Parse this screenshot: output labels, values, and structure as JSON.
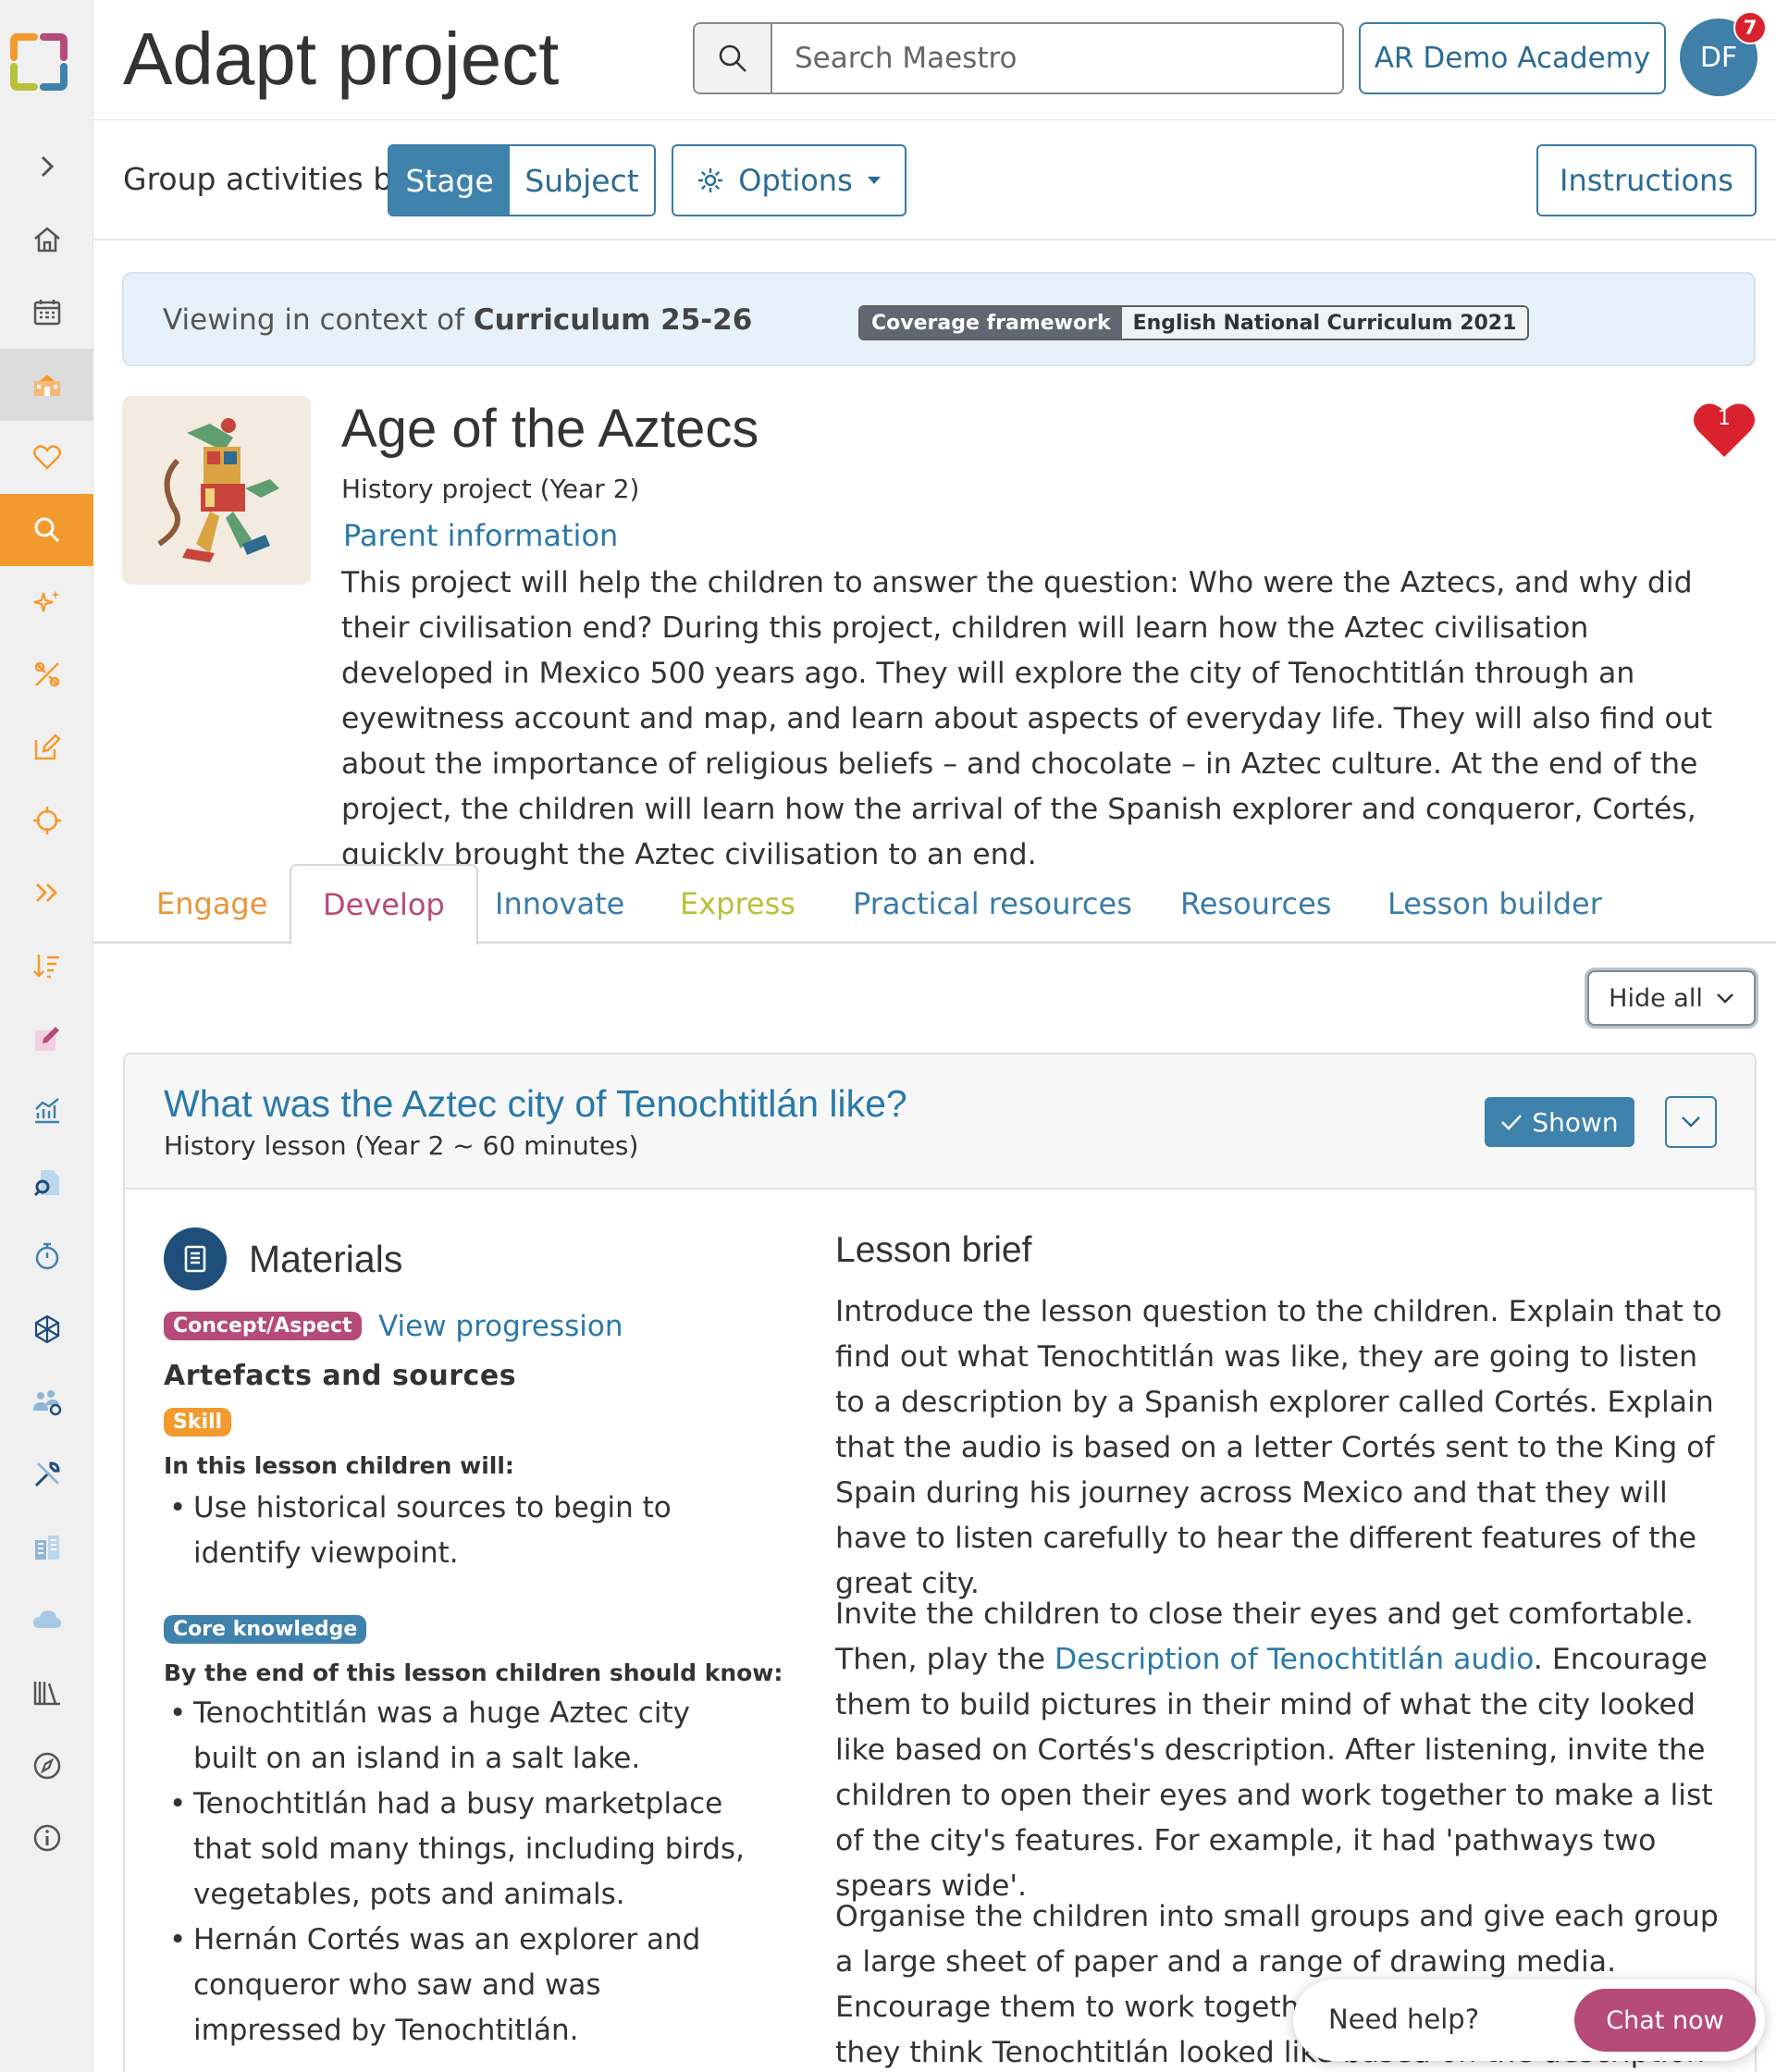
{
  "header": {
    "title": "Adapt project",
    "search_placeholder": "Search Maestro",
    "school": "AR Demo Academy",
    "avatar_initials": "DF",
    "notification_count": "7"
  },
  "toolbar": {
    "group_label": "Group activities by",
    "segments": [
      "Stage",
      "Subject"
    ],
    "active_segment": "Stage",
    "options_label": "Options",
    "instructions_label": "Instructions"
  },
  "context": {
    "prefix": "Viewing in context of ",
    "curriculum": "Curriculum 25-26",
    "badge_key": "Coverage framework",
    "badge_value": "English National Curriculum 2021"
  },
  "project": {
    "title": "Age of the Aztecs",
    "subtitle": "History project (Year 2)",
    "parent_link": "Parent information",
    "description": "This project will help the children to answer the question: Who were the Aztecs, and why did their civilisation end? During this project, children will learn how the Aztec civilisation developed in Mexico 500 years ago. They will explore the city of Tenochtitlán through an eyewitness account and map, and learn about aspects of everyday life. They will also find out about the importance of religious beliefs – and chocolate – in Aztec culture. At the end of the project, the children will learn how the arrival of the Spanish explorer and conqueror, Cortés, quickly brought the Aztec civilisation to an end.",
    "favourite_count": "1"
  },
  "tabs": [
    {
      "label": "Engage",
      "color": "#e8963a"
    },
    {
      "label": "Develop",
      "color": "#b64a79"
    },
    {
      "label": "Innovate",
      "color": "#3a7ca5"
    },
    {
      "label": "Express",
      "color": "#b7c23a"
    },
    {
      "label": "Practical resources",
      "color": "#3a7ca5"
    },
    {
      "label": "Resources",
      "color": "#3a7ca5"
    },
    {
      "label": "Lesson builder",
      "color": "#3a7ca5"
    }
  ],
  "active_tab": "Develop",
  "hide_all_label": "Hide all",
  "lesson": {
    "title": "What was the Aztec city of Tenochtitlán like?",
    "subtitle": "History lesson (Year 2 ~ 60 minutes)",
    "shown_label": "Shown",
    "materials_title": "Materials",
    "concept_tag": "Concept/Aspect",
    "view_progression": "View progression",
    "concept_title": "Artefacts and sources",
    "skill_tag": "Skill",
    "skill_lead": "In this lesson children will:",
    "skill_items": [
      "Use historical sources to begin to identify viewpoint."
    ],
    "core_tag": "Core knowledge",
    "core_lead": "By the end of this lesson children should know:",
    "core_items": [
      "Tenochtitlán was a huge Aztec city built on an island in a salt lake.",
      "Tenochtitlán had a busy marketplace that sold many things, including birds, vegetables, pots and animals.",
      "Hernán Cortés was an explorer and conqueror who saw and was impressed by Tenochtitlán."
    ],
    "brief_title": "Lesson brief",
    "brief_p1": "Introduce the lesson question to the children. Explain that to find out what Tenochtitlán was like, they are going to listen to a description by a Spanish explorer called Cortés. Explain that the audio is based on a letter Cortés sent to the King of Spain during his journey across Mexico and that they will have to listen carefully to hear the different features of the great city.",
    "brief_p2_pre": "Invite the children to close their eyes and get comfortable. Then, play the ",
    "brief_p2_link": "Description of Tenochtitlán audio",
    "brief_p2_post": ". Encourage them to build pictures in their mind of what the city looked like based on Cortés's description. After listening, invite the children to open their eyes and work together to make a list of the city's features. For example, it had 'pathways two spears wide'.",
    "brief_p3": "Organise the children into small groups and give each group a large sheet of paper and a range of drawing media. Encourage them to work together to draw a map of what they think Tenochtitlán looked like based on the description in"
  },
  "chat": {
    "label": "Need help?",
    "button": "Chat now"
  },
  "sidebar_icons": [
    "expand-icon",
    "home-icon",
    "calendar-icon",
    "school-icon",
    "heart-icon",
    "search-icon",
    "sparkle-icon",
    "design-icon",
    "edit-icon",
    "target-icon",
    "fast-forward-icon",
    "sort-icon",
    "pencil-icon",
    "chart-icon",
    "document-search-icon",
    "timer-icon",
    "network-icon",
    "users-settings-icon",
    "tools-icon",
    "buildings-icon",
    "cloud-icon",
    "library-icon",
    "compass-icon",
    "info-icon"
  ]
}
